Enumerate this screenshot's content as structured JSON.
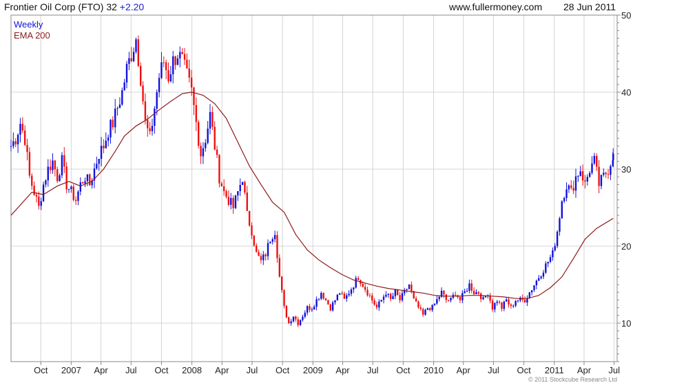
{
  "header": {
    "title_prefix": "Frontier Oil Corp (FTO) 32",
    "change": "+2.20",
    "site": "www.fullermoney.com",
    "date": "28 Jun 2011"
  },
  "legend": {
    "weekly": "Weekly",
    "ema": "EMA 200"
  },
  "copyright": "© 2011 Stockcube Research Ltd",
  "colors": {
    "up": "#1010dd",
    "down": "#ee1010",
    "ema": "#8b1a1a",
    "grid": "#d4d4d4",
    "title_change": "#2020cc"
  },
  "chart_data": {
    "type": "candlestick",
    "frequency": "weekly",
    "ylim": [
      5,
      50
    ],
    "yticks": [
      10,
      20,
      30,
      40,
      50
    ],
    "xlabels": [
      {
        "label": "Oct",
        "date": "2006-10-01"
      },
      {
        "label": "2007",
        "date": "2007-01-01"
      },
      {
        "label": "Apr",
        "date": "2007-04-01"
      },
      {
        "label": "Jul",
        "date": "2007-07-01"
      },
      {
        "label": "Oct",
        "date": "2007-10-01"
      },
      {
        "label": "2008",
        "date": "2008-01-01"
      },
      {
        "label": "Apr",
        "date": "2008-04-01"
      },
      {
        "label": "Jul",
        "date": "2008-07-01"
      },
      {
        "label": "Oct",
        "date": "2008-10-01"
      },
      {
        "label": "2009",
        "date": "2009-01-01"
      },
      {
        "label": "Apr",
        "date": "2009-04-01"
      },
      {
        "label": "Jul",
        "date": "2009-07-01"
      },
      {
        "label": "Oct",
        "date": "2009-10-01"
      },
      {
        "label": "2010",
        "date": "2010-01-01"
      },
      {
        "label": "Apr",
        "date": "2010-04-01"
      },
      {
        "label": "Jul",
        "date": "2010-07-01"
      },
      {
        "label": "Oct",
        "date": "2010-10-01"
      },
      {
        "label": "2011",
        "date": "2011-01-01"
      },
      {
        "label": "Apr",
        "date": "2011-04-01"
      },
      {
        "label": "Jul",
        "date": "2011-07-01"
      }
    ],
    "close_series": [
      [
        "2006-07-03",
        33
      ],
      [
        "2006-07-17",
        34
      ],
      [
        "2006-07-31",
        36
      ],
      [
        "2006-08-14",
        34
      ],
      [
        "2006-08-28",
        29
      ],
      [
        "2006-09-11",
        27
      ],
      [
        "2006-09-25",
        25
      ],
      [
        "2006-10-09",
        28
      ],
      [
        "2006-10-23",
        30
      ],
      [
        "2006-11-06",
        31
      ],
      [
        "2006-11-20",
        29
      ],
      [
        "2006-12-04",
        31
      ],
      [
        "2006-12-18",
        28
      ],
      [
        "2007-01-01",
        27
      ],
      [
        "2007-01-15",
        26
      ],
      [
        "2007-01-29",
        28
      ],
      [
        "2007-02-12",
        29
      ],
      [
        "2007-02-26",
        28
      ],
      [
        "2007-03-12",
        30
      ],
      [
        "2007-03-26",
        32
      ],
      [
        "2007-04-09",
        33
      ],
      [
        "2007-04-23",
        35
      ],
      [
        "2007-05-07",
        36
      ],
      [
        "2007-05-21",
        38
      ],
      [
        "2007-06-04",
        40
      ],
      [
        "2007-06-18",
        43
      ],
      [
        "2007-07-02",
        45
      ],
      [
        "2007-07-16",
        47
      ],
      [
        "2007-07-30",
        42
      ],
      [
        "2007-08-13",
        36
      ],
      [
        "2007-08-27",
        34
      ],
      [
        "2007-09-10",
        38
      ],
      [
        "2007-09-24",
        42
      ],
      [
        "2007-10-08",
        44
      ],
      [
        "2007-10-22",
        42
      ],
      [
        "2007-11-05",
        44
      ],
      [
        "2007-11-19",
        45
      ],
      [
        "2007-12-03",
        44
      ],
      [
        "2007-12-17",
        42
      ],
      [
        "2007-12-31",
        40
      ],
      [
        "2008-01-14",
        36
      ],
      [
        "2008-01-28",
        32
      ],
      [
        "2008-02-11",
        34
      ],
      [
        "2008-02-25",
        37
      ],
      [
        "2008-03-10",
        33
      ],
      [
        "2008-03-24",
        29
      ],
      [
        "2008-04-07",
        27
      ],
      [
        "2008-04-21",
        26
      ],
      [
        "2008-05-05",
        25
      ],
      [
        "2008-05-19",
        27
      ],
      [
        "2008-06-02",
        29
      ],
      [
        "2008-06-16",
        24
      ],
      [
        "2008-06-30",
        22
      ],
      [
        "2008-07-14",
        19
      ],
      [
        "2008-07-28",
        18
      ],
      [
        "2008-08-11",
        19
      ],
      [
        "2008-08-25",
        21
      ],
      [
        "2008-09-08",
        22
      ],
      [
        "2008-09-22",
        16
      ],
      [
        "2008-10-06",
        12
      ],
      [
        "2008-10-20",
        10
      ],
      [
        "2008-11-03",
        11
      ],
      [
        "2008-11-17",
        10
      ],
      [
        "2008-12-01",
        11
      ],
      [
        "2008-12-15",
        12
      ],
      [
        "2008-12-29",
        12
      ],
      [
        "2009-01-12",
        13
      ],
      [
        "2009-01-26",
        14
      ],
      [
        "2009-02-09",
        13
      ],
      [
        "2009-02-23",
        12
      ],
      [
        "2009-03-09",
        13
      ],
      [
        "2009-03-23",
        14
      ],
      [
        "2009-04-06",
        13
      ],
      [
        "2009-04-20",
        14
      ],
      [
        "2009-05-04",
        15
      ],
      [
        "2009-05-18",
        16
      ],
      [
        "2009-06-01",
        15
      ],
      [
        "2009-06-15",
        14
      ],
      [
        "2009-06-29",
        13
      ],
      [
        "2009-07-13",
        12
      ],
      [
        "2009-07-27",
        13
      ],
      [
        "2009-08-10",
        14
      ],
      [
        "2009-08-24",
        13
      ],
      [
        "2009-09-07",
        14
      ],
      [
        "2009-09-21",
        13
      ],
      [
        "2009-10-05",
        14
      ],
      [
        "2009-10-19",
        15
      ],
      [
        "2009-11-02",
        13
      ],
      [
        "2009-11-16",
        12
      ],
      [
        "2009-11-30",
        11
      ],
      [
        "2009-12-14",
        12
      ],
      [
        "2009-12-28",
        12
      ],
      [
        "2010-01-11",
        13
      ],
      [
        "2010-01-25",
        14
      ],
      [
        "2010-02-08",
        13
      ],
      [
        "2010-02-22",
        13
      ],
      [
        "2010-03-08",
        14
      ],
      [
        "2010-03-22",
        13
      ],
      [
        "2010-04-05",
        14
      ],
      [
        "2010-04-19",
        15
      ],
      [
        "2010-05-03",
        14
      ],
      [
        "2010-05-17",
        14
      ],
      [
        "2010-05-31",
        13
      ],
      [
        "2010-06-14",
        14
      ],
      [
        "2010-06-28",
        12
      ],
      [
        "2010-07-12",
        13
      ],
      [
        "2010-07-26",
        12
      ],
      [
        "2010-08-09",
        13
      ],
      [
        "2010-08-23",
        12
      ],
      [
        "2010-09-06",
        13
      ],
      [
        "2010-09-20",
        13
      ],
      [
        "2010-10-04",
        13
      ],
      [
        "2010-10-18",
        14
      ],
      [
        "2010-11-01",
        15
      ],
      [
        "2010-11-15",
        16
      ],
      [
        "2010-11-29",
        17
      ],
      [
        "2010-12-13",
        18
      ],
      [
        "2010-12-27",
        19
      ],
      [
        "2011-01-10",
        22
      ],
      [
        "2011-01-24",
        26
      ],
      [
        "2011-02-07",
        28
      ],
      [
        "2011-02-21",
        27
      ],
      [
        "2011-03-07",
        29
      ],
      [
        "2011-03-21",
        30
      ],
      [
        "2011-04-04",
        28
      ],
      [
        "2011-04-18",
        30
      ],
      [
        "2011-05-02",
        31
      ],
      [
        "2011-05-16",
        28
      ],
      [
        "2011-05-30",
        29
      ],
      [
        "2011-06-13",
        30
      ],
      [
        "2011-06-28",
        32
      ]
    ],
    "ema_series": [
      [
        "2006-07-03",
        24
      ],
      [
        "2006-09-04",
        27
      ],
      [
        "2006-10-09",
        26.7
      ],
      [
        "2006-11-20",
        27.8
      ],
      [
        "2006-12-25",
        28.4
      ],
      [
        "2007-01-29",
        27.8
      ],
      [
        "2007-03-05",
        28.4
      ],
      [
        "2007-04-09",
        30
      ],
      [
        "2007-05-14",
        32.3
      ],
      [
        "2007-06-11",
        34.3
      ],
      [
        "2007-07-16",
        35.6
      ],
      [
        "2007-08-20",
        36.5
      ],
      [
        "2007-09-24",
        37.7
      ],
      [
        "2007-10-29",
        38.8
      ],
      [
        "2007-12-03",
        39.8
      ],
      [
        "2007-12-31",
        40
      ],
      [
        "2008-02-04",
        39.6
      ],
      [
        "2008-03-10",
        38.5
      ],
      [
        "2008-04-14",
        36.6
      ],
      [
        "2008-05-19",
        33.5
      ],
      [
        "2008-06-23",
        30.4
      ],
      [
        "2008-07-28",
        28
      ],
      [
        "2008-09-01",
        25.7
      ],
      [
        "2008-10-06",
        24.4
      ],
      [
        "2008-11-10",
        21.5
      ],
      [
        "2008-12-15",
        19.5
      ],
      [
        "2009-01-19",
        18.2
      ],
      [
        "2009-02-23",
        17.2
      ],
      [
        "2009-03-30",
        16.3
      ],
      [
        "2009-05-04",
        15.6
      ],
      [
        "2009-06-08",
        15.2
      ],
      [
        "2009-07-13",
        14.8
      ],
      [
        "2009-08-17",
        14.5
      ],
      [
        "2009-09-21",
        14.3
      ],
      [
        "2009-10-26",
        14.1
      ],
      [
        "2009-11-30",
        13.9
      ],
      [
        "2010-01-04",
        13.6
      ],
      [
        "2010-02-08",
        13.5
      ],
      [
        "2010-03-15",
        13.5
      ],
      [
        "2010-04-19",
        13.6
      ],
      [
        "2010-05-24",
        13.6
      ],
      [
        "2010-06-28",
        13.5
      ],
      [
        "2010-08-02",
        13.4
      ],
      [
        "2010-09-06",
        13.2
      ],
      [
        "2010-10-11",
        13.2
      ],
      [
        "2010-11-15",
        13.6
      ],
      [
        "2010-12-20",
        14.6
      ],
      [
        "2011-01-24",
        16
      ],
      [
        "2011-02-28",
        18.4
      ],
      [
        "2011-04-04",
        20.9
      ],
      [
        "2011-05-09",
        22.3
      ],
      [
        "2011-06-28",
        23.6
      ]
    ]
  }
}
